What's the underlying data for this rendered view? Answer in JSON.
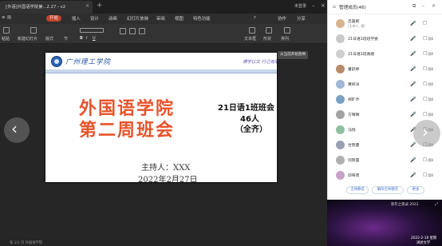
{
  "ppt": {
    "doc_tab": "[外语]外国语学院第...2.27 - v2",
    "login": "未登录",
    "ribbon_tabs": [
      "开始",
      "插入",
      "设计",
      "动画",
      "幻灯片放映",
      "审阅",
      "视图",
      "特色功能"
    ],
    "right_tools": [
      "协作",
      "分享"
    ],
    "toolbar_items": [
      "粘贴",
      "新建幻灯片",
      "版式",
      "节",
      "文本框",
      "形状",
      "排列"
    ],
    "float_tip": "从当前开始放映",
    "status": "第 1/1 页  外国语学院"
  },
  "slide": {
    "school": "广州理工学院",
    "motto": "博学以文 行己有耻",
    "title_line1": "外国语学院",
    "title_line2": "第二周班会",
    "class_name": "21日语1班班会",
    "count": "46人",
    "all": "（全齐）",
    "host": "主持人：XXX",
    "date": "2022年2月27日"
  },
  "panel": {
    "title": "管理成员(46)",
    "members": [
      {
        "name": "吕嘉妮",
        "sub": "(主持人, 我)",
        "mic": "🎤",
        "cam": "□",
        "cam_label": ""
      },
      {
        "name": "21日语1班班学委",
        "sub": "",
        "mic": "🎤",
        "cam": "□",
        "cam_label": "用8"
      },
      {
        "name": "21日语1班谢婕",
        "sub": "",
        "mic": "🎤",
        "cam": "□",
        "cam_label": "用8"
      },
      {
        "name": "董舒婷",
        "sub": "",
        "mic": "🎤",
        "cam": "□",
        "cam_label": "用8"
      },
      {
        "name": "黄梓洋",
        "sub": "",
        "mic": "🎤",
        "cam": "□",
        "cam_label": "用8"
      },
      {
        "name": "郑旷乔",
        "sub": "",
        "mic": "🎤",
        "cam": "□",
        "cam_label": "用8"
      },
      {
        "name": "方晴晴",
        "sub": "",
        "mic": "🎤",
        "cam": "□",
        "cam_label": "用8"
      },
      {
        "name": "冯悦",
        "sub": "",
        "mic": "🎤",
        "cam": "□",
        "cam_label": "用8"
      },
      {
        "name": "甘晓蔓",
        "sub": "",
        "mic": "🎤",
        "cam": "□",
        "cam_label": "用8"
      },
      {
        "name": "何晓蕾",
        "sub": "",
        "mic": "🎤",
        "cam": "□",
        "cam_label": "用8"
      },
      {
        "name": "邱蒂周",
        "sub": "",
        "mic": "🎤",
        "cam": "□",
        "cam_label": "用8"
      }
    ],
    "btn_mute_all": "全体静音",
    "btn_unmute_all": "解除全体静音",
    "btn_more": "更多"
  },
  "video": {
    "tag": "新年之夜录 2022",
    "line1": "2022-2-18 星期",
    "line2": "讲述文学"
  },
  "colors": {
    "accent": "#c0442a",
    "title_red": "#e8532b",
    "school_blue": "#2455a4"
  }
}
